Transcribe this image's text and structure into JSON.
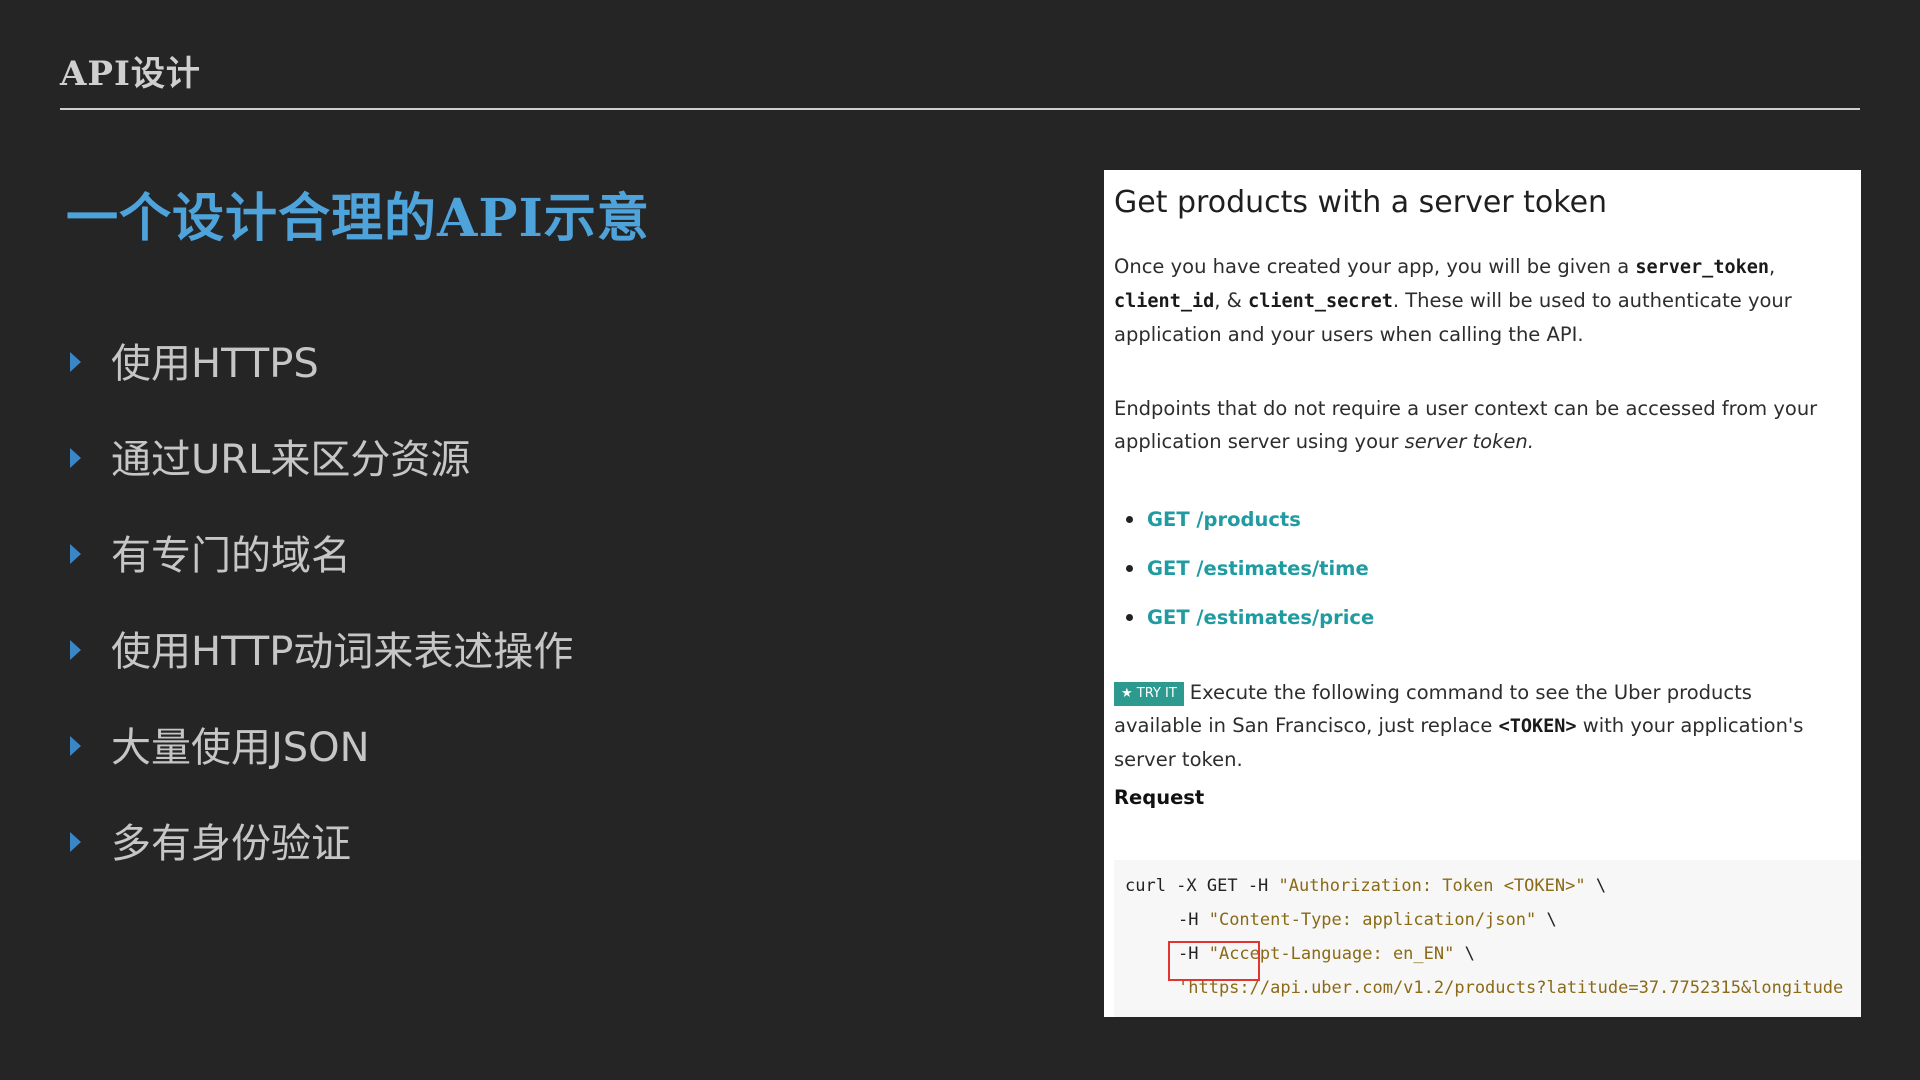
{
  "header": {
    "title": "API设计"
  },
  "slide": {
    "title": "一个设计合理的API示意",
    "bullets": [
      "使用HTTPS",
      "通过URL来区分资源",
      "有专门的域名",
      "使用HTTP动词来表述操作",
      "大量使用JSON",
      "多有身份验证"
    ]
  },
  "doc": {
    "heading": "Get products with a server token",
    "p1_a": "Once you have created your app, you will be given a ",
    "p1_code1": "server_token",
    "p1_b": ",",
    "p1_code2": "client_id",
    "p1_c": ", & ",
    "p1_code3": "client_secret",
    "p1_d": ". These will be used to authenticate your application and your users when calling the API.",
    "p2_a": "Endpoints that do not require a user context can be accessed from your application server using your ",
    "p2_em": "server token.",
    "endpoints": [
      "GET /products",
      "GET /estimates/time",
      "GET /estimates/price"
    ],
    "try_badge": "★ TRY IT",
    "p3_a": "Execute the following command to see the Uber products available in San Francisco, just replace ",
    "p3_code": "<TOKEN>",
    "p3_b": " with your application's server token.",
    "request_label": "Request",
    "code": {
      "l1_cmd": "curl -X GET -H ",
      "l1_str": "\"Authorization: Token <TOKEN>\"",
      "l1_end": " \\",
      "l2_flag": "-H ",
      "l2_str": "\"Content-Type: application/json\"",
      "l2_end": " \\",
      "l3_flag": "-H ",
      "l3_str": "\"Accept-Language: en_EN\"",
      "l3_end": " \\",
      "l4_str1": "'https:",
      "l4_rest": "//api.uber.com/v1.2/products?latitude=37.7752315&longitude"
    }
  },
  "colors": {
    "background": "#252526",
    "accent_blue": "#4fa3db",
    "bullet_marker": "#3a86c6",
    "link_teal": "#1f9ba1",
    "badge_teal": "#2c9a8f",
    "highlight_red": "#e2352f"
  }
}
